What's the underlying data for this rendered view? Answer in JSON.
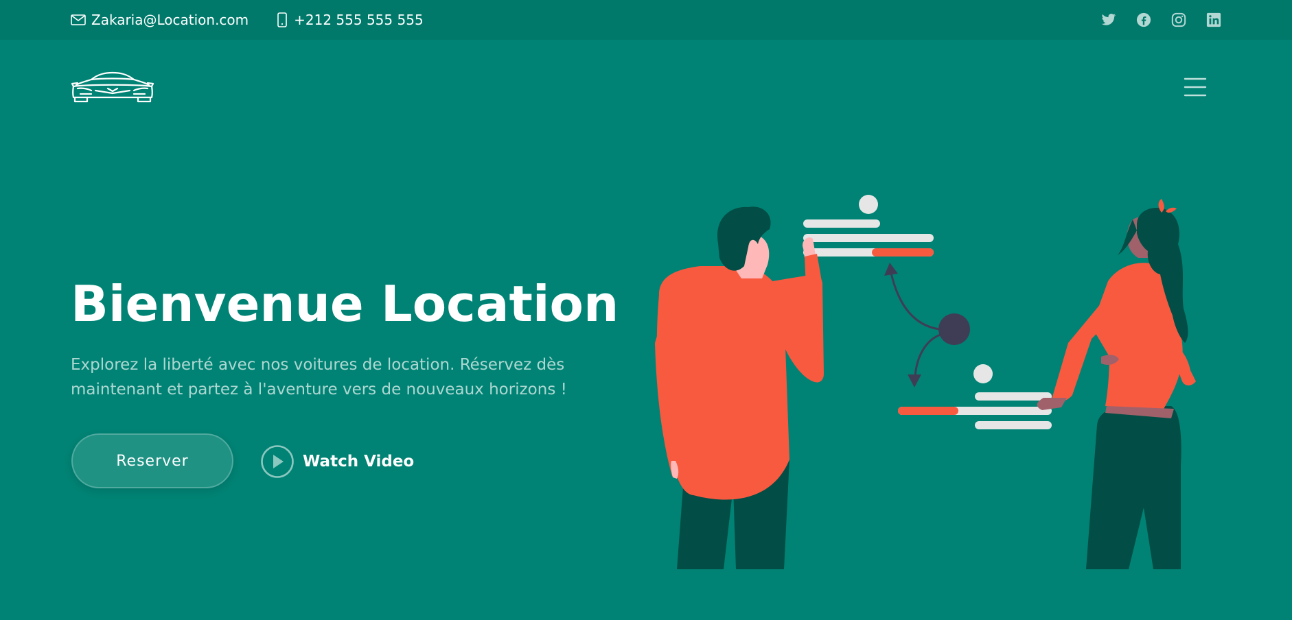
{
  "topbar": {
    "email": "Zakaria@Location.com",
    "phone": "+212 555 555 555",
    "social": [
      "twitter-icon",
      "facebook-icon",
      "instagram-icon",
      "linkedin-icon"
    ]
  },
  "header": {
    "logo_icon": "car-logo-icon",
    "menu_icon": "hamburger-menu-icon"
  },
  "hero": {
    "title": "Bienvenue Location",
    "text": "Explorez la liberté avec nos voitures de location. Réservez dès maintenant et partez à l'aventure vers de nouveaux horizons !",
    "reserve_label": "Reserver",
    "watch_label": "Watch Video"
  },
  "colors": {
    "background": "#008374",
    "topbar": "#00796b",
    "accent": "#f85a40",
    "dark_green": "#024d45"
  }
}
